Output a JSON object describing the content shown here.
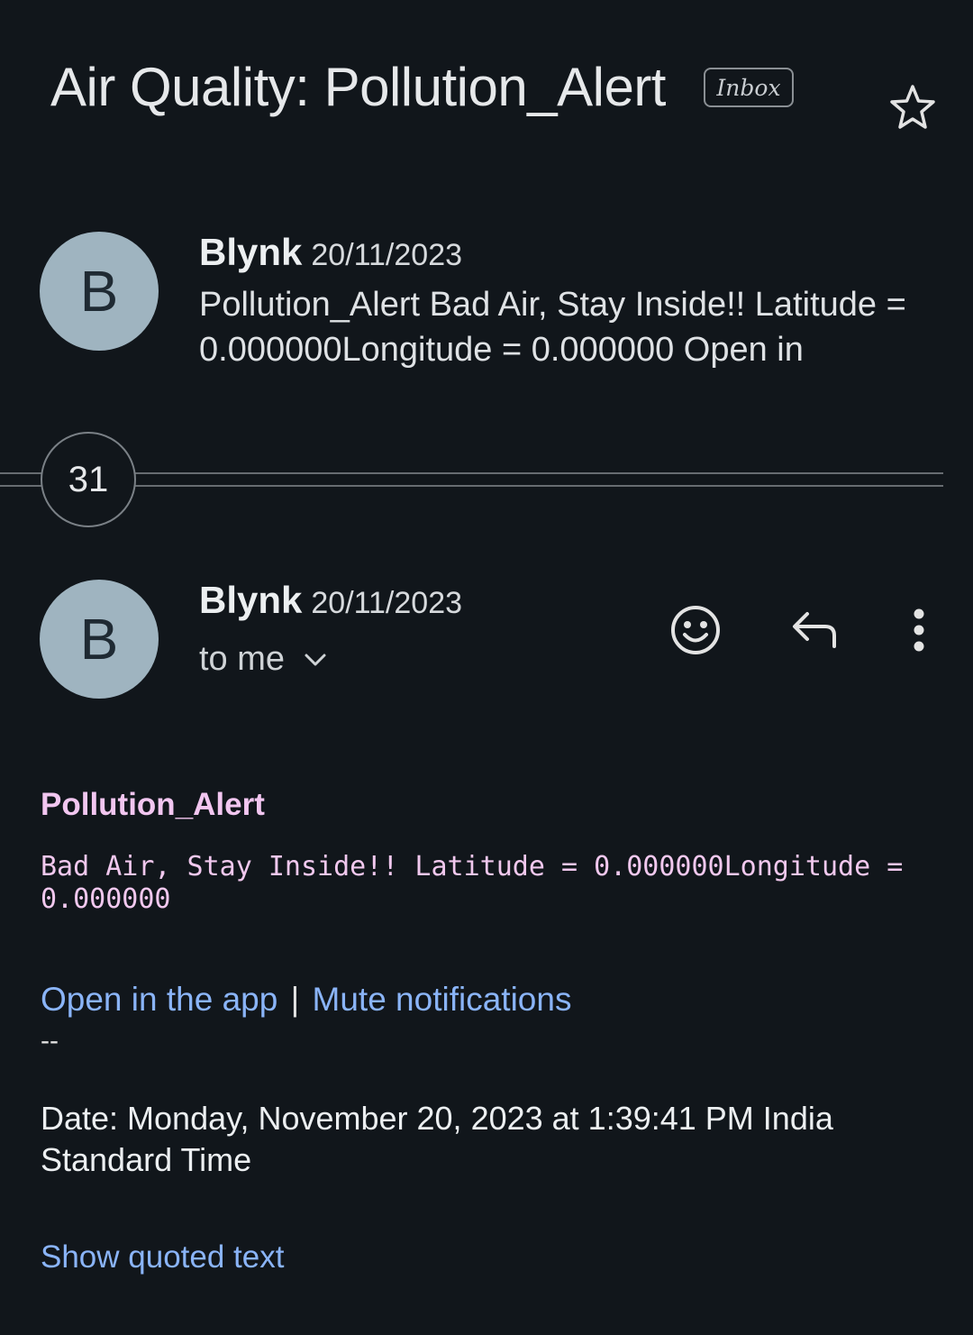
{
  "thread": {
    "subject": "Air Quality: Pollution_Alert",
    "label": "Inbox",
    "star_icon": "star-outline-icon"
  },
  "collapsed_message": {
    "avatar_letter": "B",
    "sender": "Blynk",
    "date": "20/11/2023",
    "snippet": "Pollution_Alert Bad Air, Stay Inside!! Latitude = 0.000000Longitude = 0.000000 Open in"
  },
  "hidden_count": "31",
  "open_message": {
    "avatar_letter": "B",
    "sender": "Blynk",
    "date": "20/11/2023",
    "recipient": "to me",
    "actions": {
      "react_icon": "smiley-icon",
      "reply_icon": "reply-icon",
      "more_icon": "more-vert-icon"
    }
  },
  "body": {
    "title": "Pollution_Alert",
    "mono_text": "Bad Air, Stay Inside!! Latitude = 0.000000Longitude =\n0.000000",
    "link_open_app": "Open in the app",
    "link_separator": "|",
    "link_mute": "Mute notifications",
    "signature": "--",
    "date_text": "Date: Monday, November 20, 2023 at 1:39:41 PM India Standard Time",
    "show_quoted": "Show quoted text"
  },
  "colors": {
    "background": "#11161b",
    "avatar": "#9fb4c0",
    "link": "#8ab4f8",
    "body_pink": "#f1c8ee"
  }
}
